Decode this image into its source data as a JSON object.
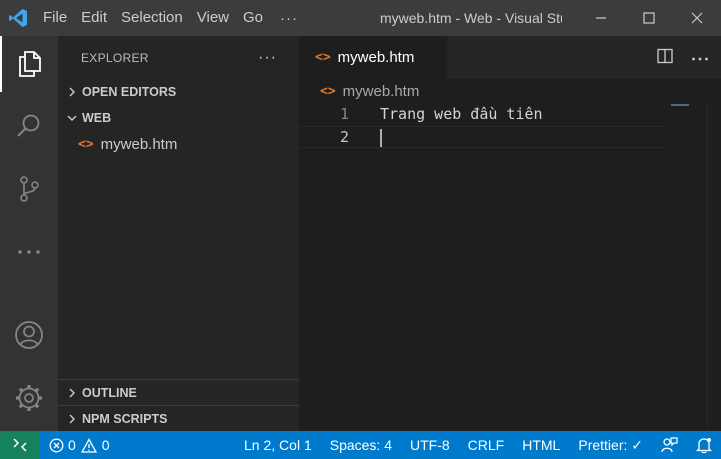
{
  "titlebar": {
    "menu": [
      "File",
      "Edit",
      "Selection",
      "View",
      "Go"
    ],
    "more": "···",
    "window_title": "myweb.htm - Web - Visual Studio Code",
    "icons": [
      "vscode-logo-icon",
      "minimize-icon",
      "maximize-icon",
      "close-icon"
    ]
  },
  "activitybar": {
    "icons": [
      "explorer-icon",
      "search-icon",
      "source-control-icon",
      "more-icon",
      "account-icon",
      "settings-gear-icon"
    ]
  },
  "sidebar": {
    "title": "EXPLORER",
    "more": "···",
    "sections": {
      "open_editors": "OPEN EDITORS",
      "workspace": "WEB",
      "outline": "OUTLINE",
      "npm_scripts": "NPM SCRIPTS"
    },
    "files": [
      {
        "name": "myweb.htm",
        "icon": "<>"
      }
    ]
  },
  "editor": {
    "tab": {
      "label": "myweb.htm",
      "icon": "<>"
    },
    "breadcrumb": {
      "label": "myweb.htm",
      "icon": "<>"
    },
    "lines": [
      {
        "number": "1",
        "text": "Trang web đầu tiên"
      },
      {
        "number": "2",
        "text": ""
      }
    ],
    "accent_color": "#e37933"
  },
  "statusbar": {
    "errors": "0",
    "warnings": "0",
    "position": "Ln 2, Col 1",
    "spaces": "Spaces: 4",
    "encoding": "UTF-8",
    "eol": "CRLF",
    "language": "HTML",
    "prettier": "Prettier: ✓",
    "background_color": "#007acc",
    "remote_color": "#16825d"
  }
}
